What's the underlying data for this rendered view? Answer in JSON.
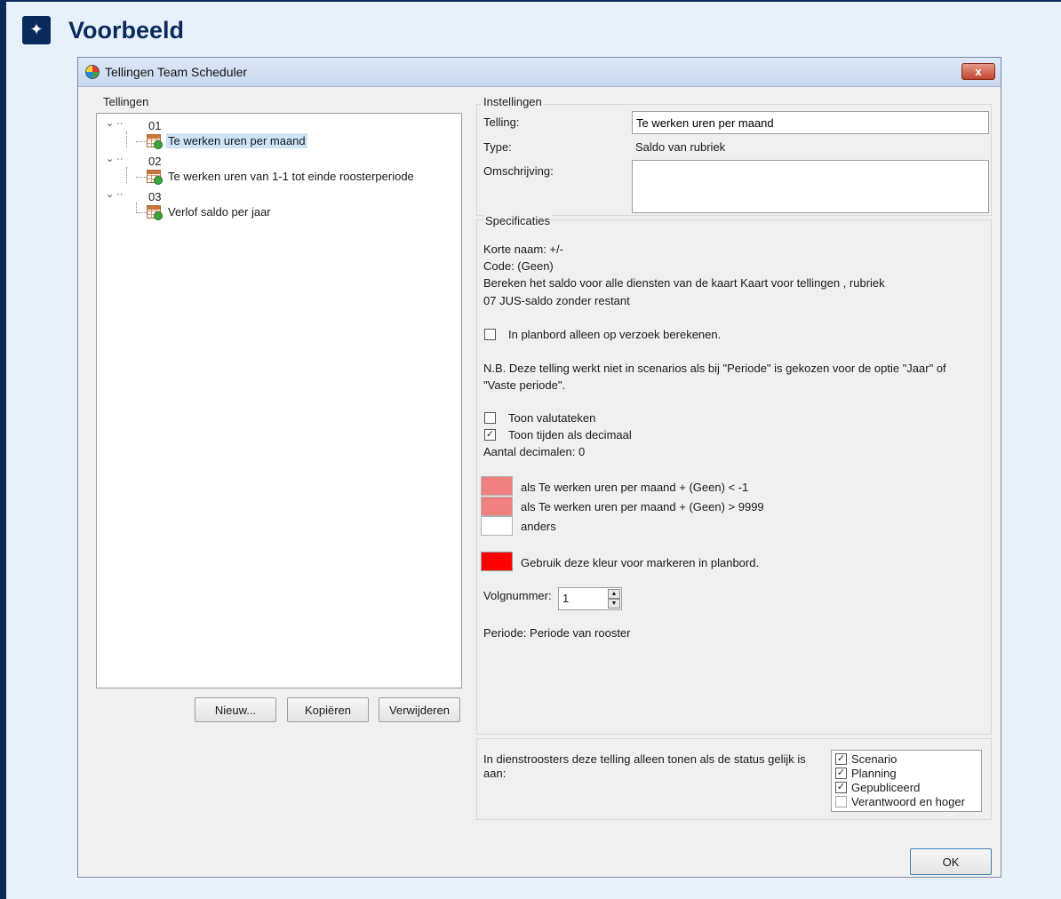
{
  "callout": {
    "icon": "sparkle-icon",
    "title": "Voorbeeld"
  },
  "window": {
    "title": "Tellingen Team Scheduler",
    "close": "x"
  },
  "left": {
    "group_label": "Tellingen",
    "tree": [
      {
        "node": "01",
        "leaf": "Te werken uren per maand",
        "selected": true
      },
      {
        "node": "02",
        "leaf": "Te werken uren van 1-1 tot einde roosterperiode",
        "selected": false
      },
      {
        "node": "03",
        "leaf": "Verlof saldo per jaar",
        "selected": false
      }
    ],
    "buttons": {
      "new": "Nieuw...",
      "copy": "Kopiëren",
      "delete": "Verwijderen"
    }
  },
  "settings": {
    "group_label": "Instellingen",
    "telling_label": "Telling:",
    "telling_value": "Te werken uren per maand",
    "type_label": "Type:",
    "type_value": "Saldo van rubriek",
    "desc_label": "Omschrijving:",
    "desc_value": ""
  },
  "spec": {
    "group_label": "Specificaties",
    "short_name": "Korte naam: +/-",
    "code": "Code: (Geen)",
    "calc_line1": "Bereken het saldo voor alle diensten van de kaart Kaart voor tellingen , rubriek",
    "calc_line2": "07 JUS-saldo zonder restant",
    "on_request": {
      "label": "In planbord alleen op verzoek berekenen.",
      "checked": false
    },
    "note_line1": "N.B. Deze telling werkt niet in scenarios als bij \"Periode\" is gekozen voor de optie \"Jaar\" of",
    "note_line2": "\"Vaste periode\".",
    "currency": {
      "label": "Toon valutateken",
      "checked": false
    },
    "decimal": {
      "label": "Toon tijden als decimaal",
      "checked": true
    },
    "decimals_count": "Aantal decimalen:  0",
    "rules": [
      {
        "color": "#f08080",
        "text": "als Te werken uren per maand + (Geen) < -1"
      },
      {
        "color": "#f08080",
        "text": "als Te werken uren per maand + (Geen) > 9999"
      },
      {
        "color": "#ffffff",
        "text": "anders"
      }
    ],
    "marker": {
      "color": "#ff0000",
      "text": "Gebruik deze kleur voor markeren in planbord."
    },
    "seq_label": "Volgnummer:",
    "seq_value": "1",
    "period": "Periode: Periode van rooster"
  },
  "status": {
    "text_line1": "In dienstroosters deze telling alleen tonen als de status gelijk is",
    "text_line2": "aan:",
    "options": [
      {
        "label": "Scenario",
        "checked": true
      },
      {
        "label": "Planning",
        "checked": true
      },
      {
        "label": "Gepubliceerd",
        "checked": true
      },
      {
        "label": "Verantwoord en hoger",
        "checked": false
      }
    ]
  },
  "ok": "OK"
}
